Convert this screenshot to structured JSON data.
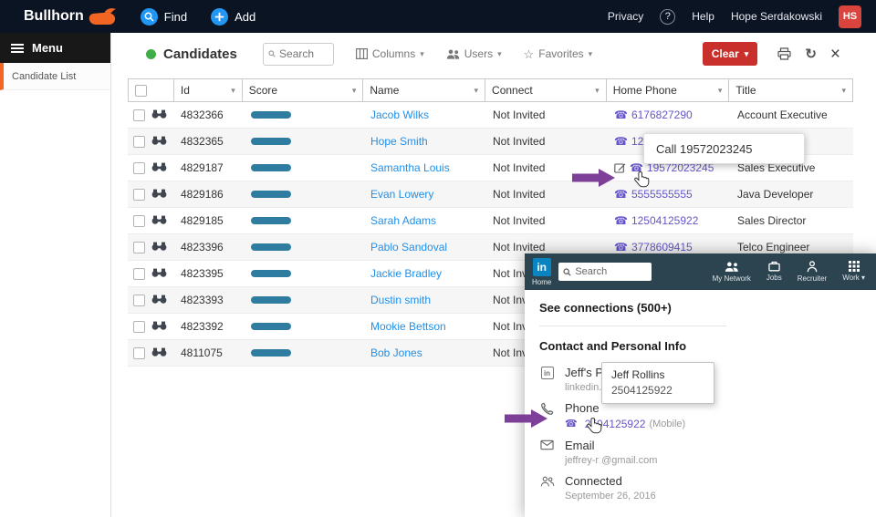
{
  "topbar": {
    "brand": "Bullhorn",
    "find_label": "Find",
    "add_label": "Add",
    "privacy_label": "Privacy",
    "help_icon": "?",
    "help_label": "Help",
    "user_name": "Hope Serdakowski",
    "user_initials": "HS"
  },
  "sidebar": {
    "menu_label": "Menu",
    "items": [
      {
        "label": "Candidate List"
      }
    ]
  },
  "toolbar": {
    "title": "Candidates",
    "search_placeholder": "Search",
    "columns_label": "Columns",
    "users_label": "Users",
    "favorites_label": "Favorites",
    "clear_label": "Clear"
  },
  "table": {
    "headers": [
      "Id",
      "Score",
      "Name",
      "Connect",
      "Home Phone",
      "Title"
    ],
    "rows": [
      {
        "id": "4832366",
        "name": "Jacob Wilks",
        "connect": "Not Invited",
        "phone": "6176827290",
        "title": "Account Executive"
      },
      {
        "id": "4832365",
        "name": "Hope Smith",
        "connect": "Not Invited",
        "phone": "120",
        "title": ""
      },
      {
        "id": "4829187",
        "name": "Samantha Louis",
        "connect": "Not Invited",
        "phone": "19572023245",
        "title": "Sales Executive"
      },
      {
        "id": "4829186",
        "name": "Evan Lowery",
        "connect": "Not Invited",
        "phone": "5555555555",
        "title": "Java Developer"
      },
      {
        "id": "4829185",
        "name": "Sarah Adams",
        "connect": "Not Invited",
        "phone": "12504125922",
        "title": "Sales Director"
      },
      {
        "id": "4823396",
        "name": "Pablo Sandoval",
        "connect": "Not Invited",
        "phone": "3778609415",
        "title": "Telco Engineer"
      },
      {
        "id": "4823395",
        "name": "Jackie Bradley",
        "connect": "Not Invited",
        "phone": "",
        "title": ""
      },
      {
        "id": "4823393",
        "name": "Dustin smith",
        "connect": "Not Invited",
        "phone": "",
        "title": ""
      },
      {
        "id": "4823392",
        "name": "Mookie Bettson",
        "connect": "Not Invited",
        "phone": "",
        "title": ""
      },
      {
        "id": "4811075",
        "name": "Bob Jones",
        "connect": "Not Invited",
        "phone": "",
        "title": ""
      }
    ]
  },
  "call_tooltip": {
    "text": "Call 19572023245"
  },
  "linkedin": {
    "logo_text": "in",
    "nav": {
      "home_label": "Home",
      "search_placeholder": "Search",
      "my_network": "My Network",
      "jobs": "Jobs",
      "recruiter": "Recruiter",
      "work": "Work"
    },
    "connections": "See connections (500+)",
    "section_title": "Contact and Personal Info",
    "profile_label": "Jeff's Profile",
    "profile_url": "linkedin.c",
    "popup": {
      "name": "Jeff Rollins",
      "phone": "2504125922"
    },
    "phone_label": "Phone",
    "phone_value": "2504125922",
    "phone_type": "(Mobile)",
    "email_label": "Email",
    "email_value": "jeffrey-r @gmail.com",
    "connected_label": "Connected",
    "connected_value": "September 26, 2016"
  },
  "colors": {
    "accent_orange": "#f26522",
    "topbar_bg": "#0b1423",
    "action_blue": "#2196f3",
    "avatar_red": "#d9453d",
    "clear_red": "#c9302c",
    "status_green": "#3fae49",
    "link_blue": "#2090ea",
    "phone_purple": "#6456c8",
    "score_bar": "#2e7c9f",
    "callout_purple": "#7d3f98",
    "linkedin_nav": "#2c4450",
    "linkedin_blue": "#0a84c1"
  }
}
